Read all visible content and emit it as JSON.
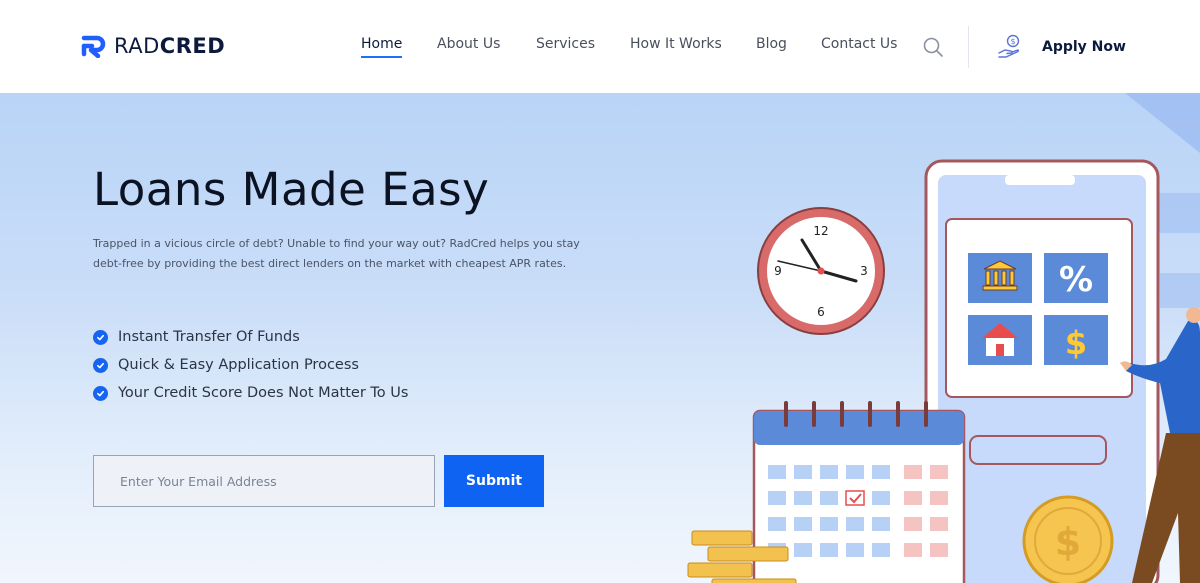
{
  "header": {
    "logo": {
      "text_light": "RAD",
      "text_bold": "CRED",
      "icon": "radcred-logo-icon"
    },
    "nav": [
      {
        "label": "Home",
        "active": true
      },
      {
        "label": "About Us",
        "active": false
      },
      {
        "label": "Services",
        "active": false
      },
      {
        "label": "How It Works",
        "active": false
      },
      {
        "label": "Blog",
        "active": false
      },
      {
        "label": "Contact Us",
        "active": false
      }
    ],
    "search_icon": "search-icon",
    "apply": {
      "label": "Apply Now",
      "icon": "money-hand-icon"
    }
  },
  "hero": {
    "title": "Loans Made Easy",
    "description": "Trapped in a vicious circle of debt? Unable to find your way out? RadCred helps you stay debt-free by providing the best direct lenders on the market with cheapest APR rates.",
    "features": [
      "Instant Transfer Of Funds",
      "Quick & Easy Application Process",
      "Your Credit Score Does Not Matter To Us"
    ],
    "email": {
      "placeholder": "Enter Your Email Address",
      "value": ""
    },
    "submit_label": "Submit",
    "illustration": {
      "clock": {
        "numbers": [
          "12",
          "3",
          "6",
          "9"
        ]
      },
      "tiles": [
        {
          "icon": "bank-icon",
          "symbol": ""
        },
        {
          "icon": "percent-icon",
          "symbol": "%"
        },
        {
          "icon": "house-icon",
          "symbol": ""
        },
        {
          "icon": "dollar-icon",
          "symbol": "$"
        }
      ],
      "coin_symbol": "$"
    }
  },
  "colors": {
    "accent": "#0f63f2",
    "brand_dark": "#0c1b3d",
    "hero_top": "#b9d4f7",
    "hero_bottom": "#f1f6fd"
  }
}
